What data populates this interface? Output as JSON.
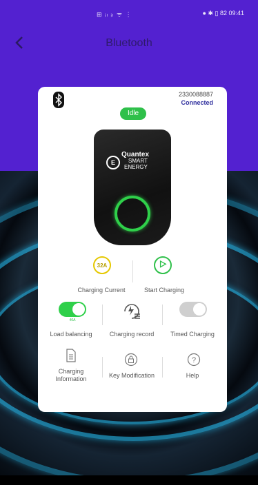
{
  "status_bar": {
    "left": "⊞ ᵢₗ ᵢₗ ᯤ ⋮",
    "right": "● ✱ ▯ 82 09:41"
  },
  "nav": {
    "title": "Bluetooth"
  },
  "device": {
    "id": "2330088887",
    "connection": "Connected",
    "state": "Idle",
    "brand_line1": "Quantex",
    "brand_line2": "SMART",
    "brand_line3": "ENERGY"
  },
  "row1": {
    "current_value": "32A",
    "current_label": "Charging Current",
    "start_label": "Start Charging"
  },
  "row2": {
    "load_balancing_value": "40A",
    "load_balancing_label": "Load balancing",
    "record_label": "Charging record",
    "timed_label": "Timed Charging"
  },
  "row3": {
    "info_label_line1": "Charging",
    "info_label_line2": "Information",
    "key_label": "Key Modification",
    "help_label": "Help"
  },
  "colors": {
    "header_bg": "#5321d0",
    "accent_green": "#2fc04a",
    "accent_yellow": "#e5c800",
    "connected_text": "#2c2c9c"
  }
}
